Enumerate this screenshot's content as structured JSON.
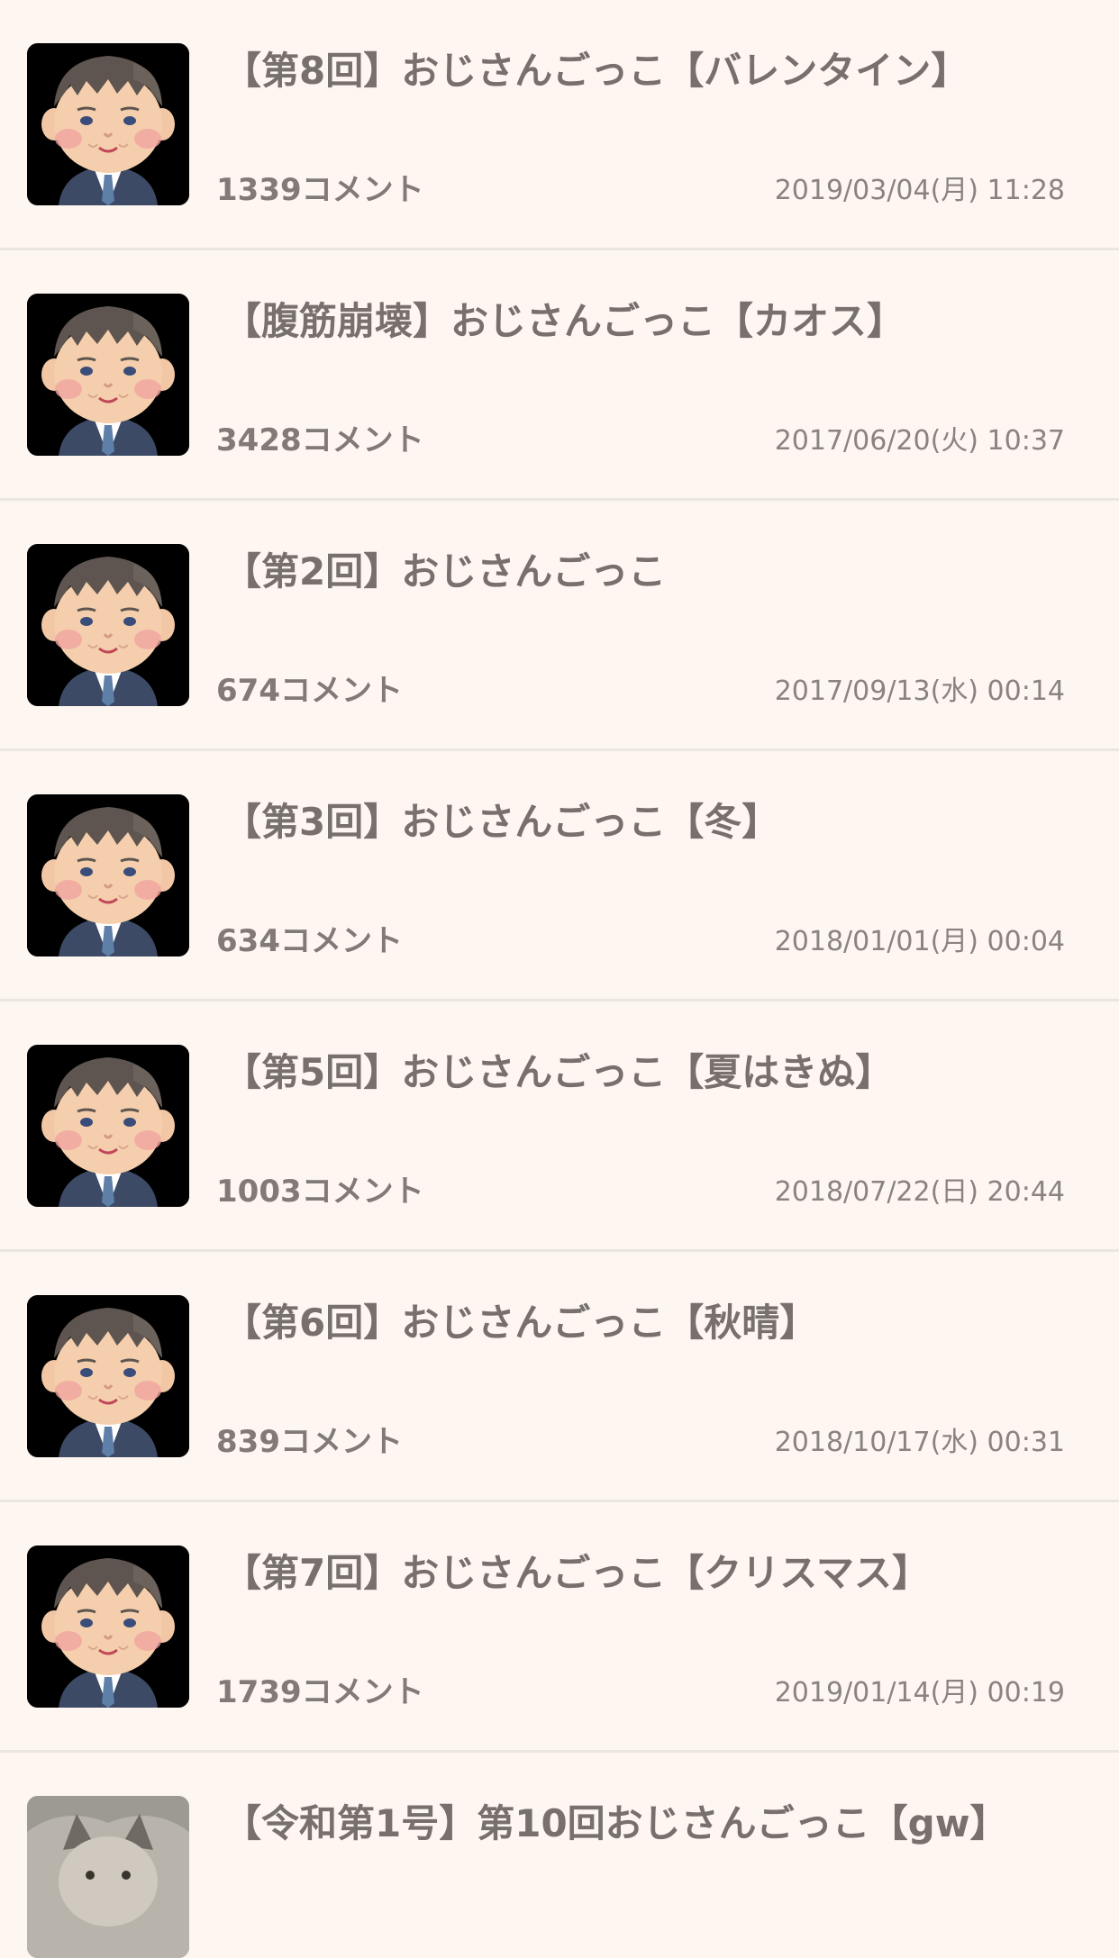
{
  "threads": [
    {
      "title": "【第8回】おじさんごっこ【バレンタイン】",
      "comments": "1339コメント",
      "date": "2019/03/04(月) 11:28",
      "thumb": "ojisan-icon"
    },
    {
      "title": "【腹筋崩壊】おじさんごっこ【カオス】",
      "comments": "3428コメント",
      "date": "2017/06/20(火) 10:37",
      "thumb": "ojisan-icon"
    },
    {
      "title": "【第2回】おじさんごっこ",
      "comments": "674コメント",
      "date": "2017/09/13(水) 00:14",
      "thumb": "ojisan-icon"
    },
    {
      "title": "【第3回】おじさんごっこ【冬】",
      "comments": "634コメント",
      "date": "2018/01/01(月) 00:04",
      "thumb": "ojisan-icon"
    },
    {
      "title": "【第5回】おじさんごっこ【夏はきぬ】",
      "comments": "1003コメント",
      "date": "2018/07/22(日) 20:44",
      "thumb": "ojisan-icon"
    },
    {
      "title": "【第6回】おじさんごっこ【秋晴】",
      "comments": "839コメント",
      "date": "2018/10/17(水) 00:31",
      "thumb": "ojisan-icon"
    },
    {
      "title": "【第7回】おじさんごっこ【クリスマス】",
      "comments": "1739コメント",
      "date": "2019/01/14(月) 00:19",
      "thumb": "ojisan-icon"
    },
    {
      "title": "【令和第1号】第10回おじさんごっこ【gw】",
      "thumb": "wolf-photo"
    }
  ],
  "colors": {
    "background": "#fdf6f1",
    "divider": "#ece6e1",
    "text": "#77706c"
  }
}
